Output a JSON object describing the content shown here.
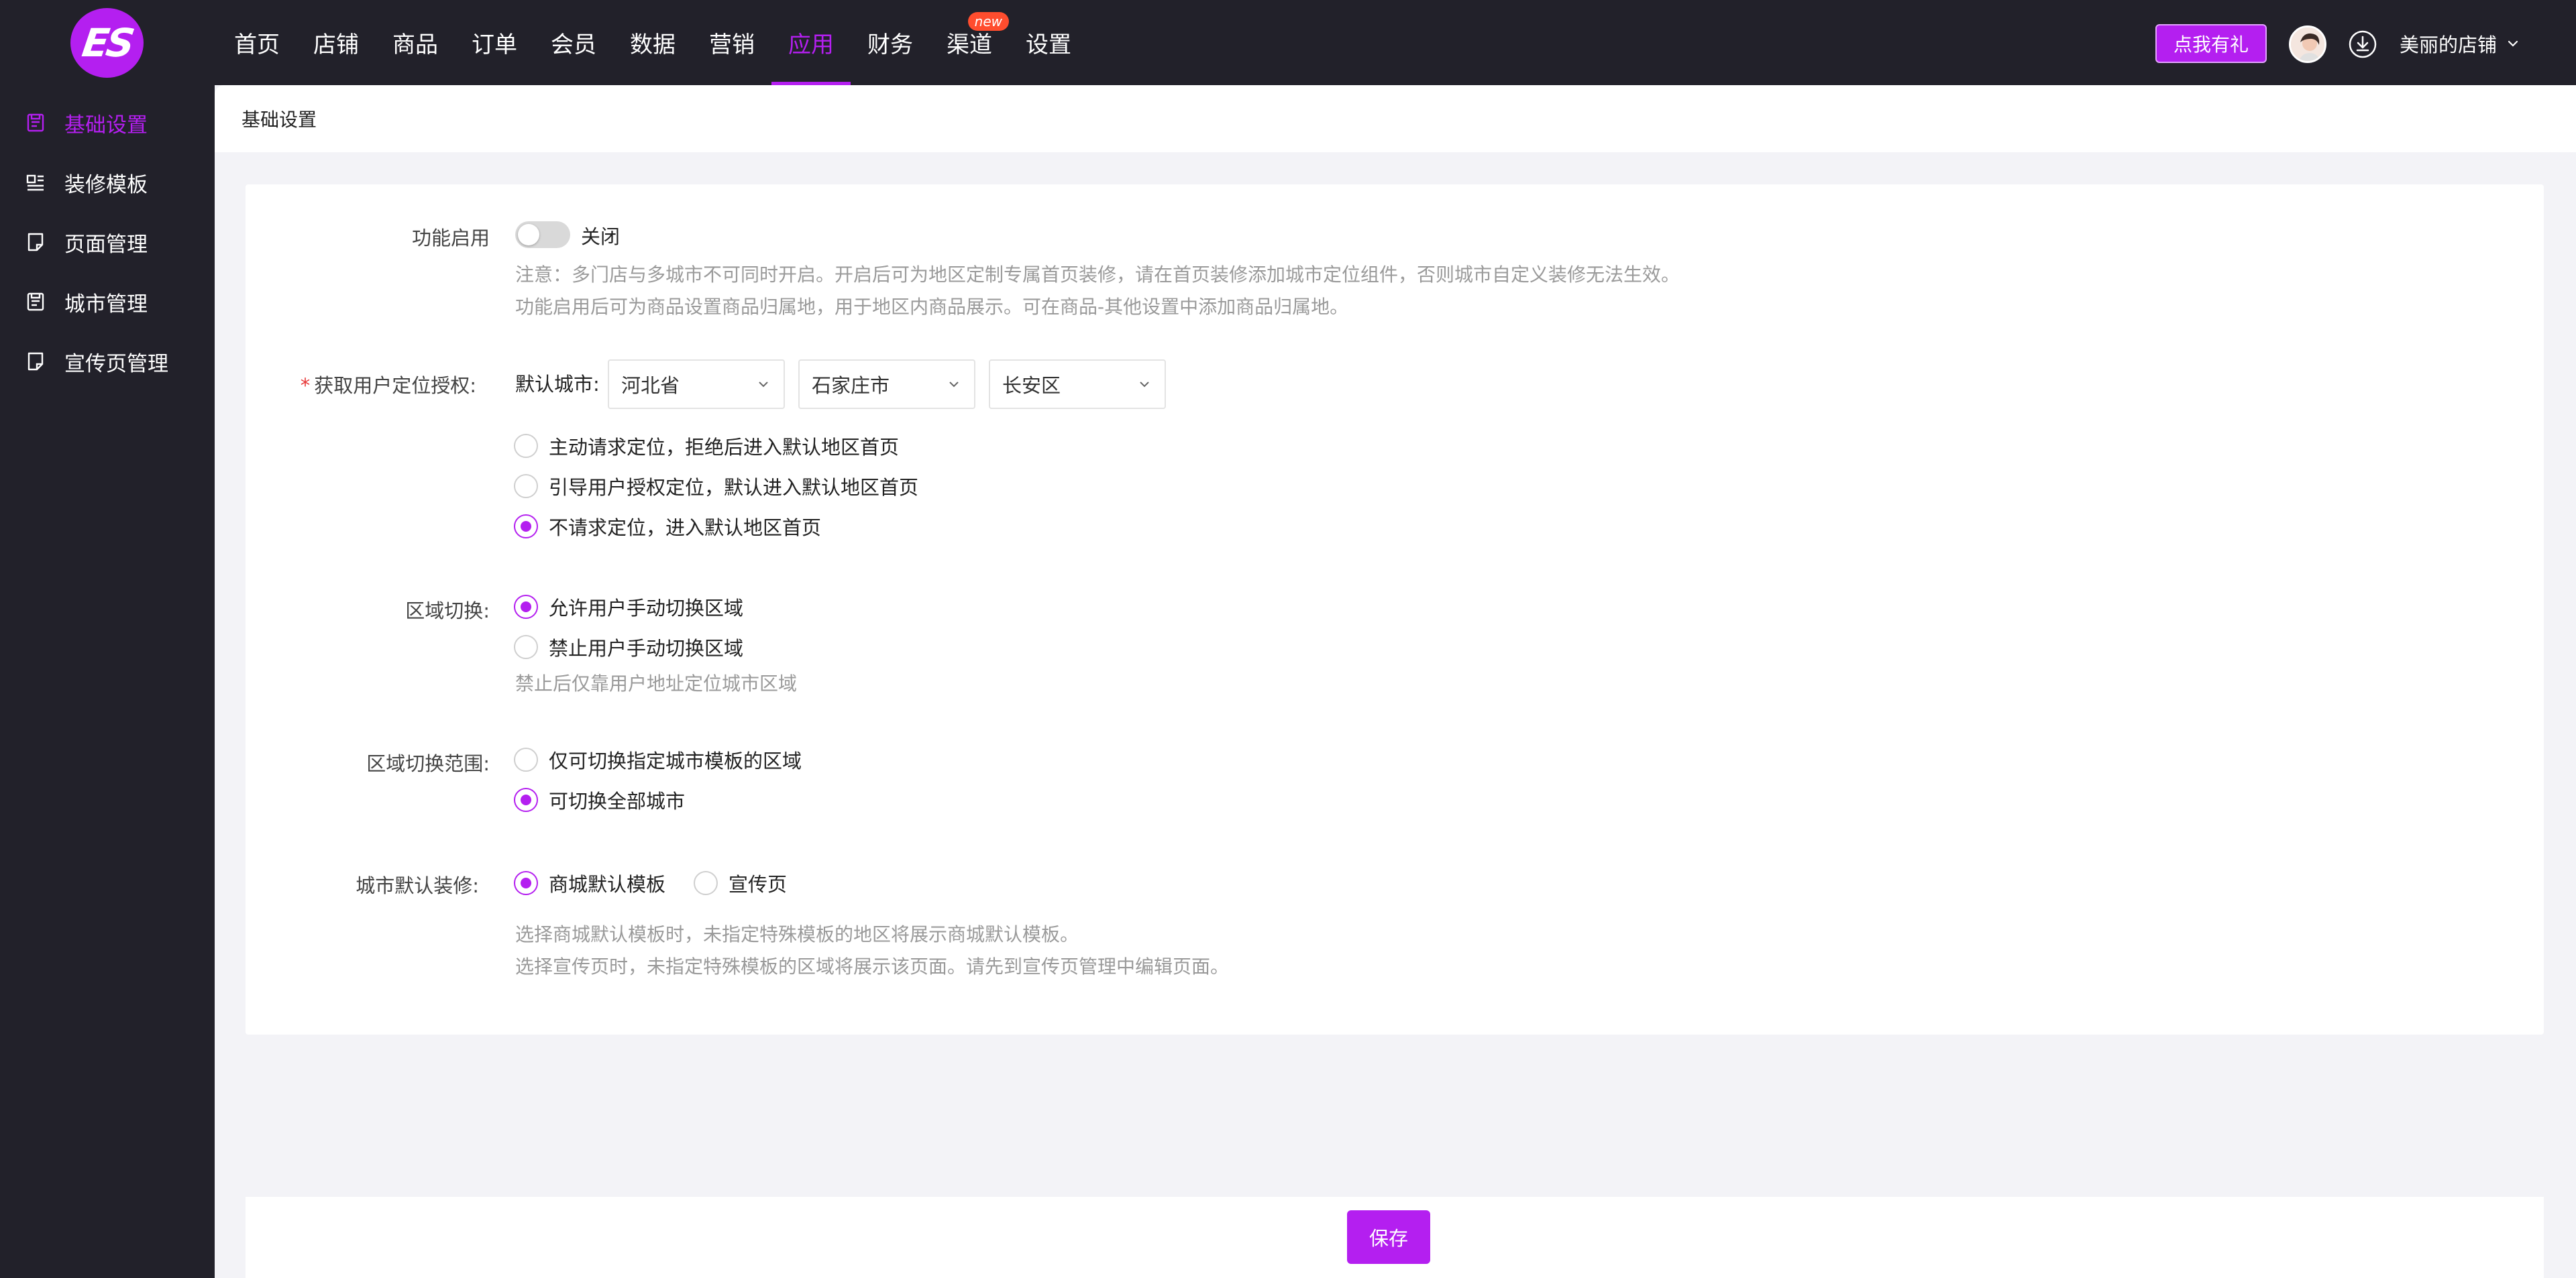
{
  "brand": {
    "logo_text": "ES",
    "accent": "#b41ff0"
  },
  "nav": [
    {
      "label": "首页"
    },
    {
      "label": "店铺"
    },
    {
      "label": "商品"
    },
    {
      "label": "订单"
    },
    {
      "label": "会员"
    },
    {
      "label": "数据"
    },
    {
      "label": "营销"
    },
    {
      "label": "应用",
      "active": true
    },
    {
      "label": "财务"
    },
    {
      "label": "渠道",
      "badge": "new"
    },
    {
      "label": "设置"
    }
  ],
  "header": {
    "gift_button": "点我有礼",
    "store_name": "美丽的店铺"
  },
  "sidebar": {
    "items": [
      {
        "label": "基础设置",
        "icon": "settings-doc-icon",
        "active": true
      },
      {
        "label": "装修模板",
        "icon": "template-icon"
      },
      {
        "label": "页面管理",
        "icon": "page-icon"
      },
      {
        "label": "城市管理",
        "icon": "city-icon"
      },
      {
        "label": "宣传页管理",
        "icon": "promo-page-icon"
      }
    ]
  },
  "tabbar": {
    "tab": "基础设置"
  },
  "form": {
    "feature": {
      "label": "功能启用",
      "toggle_text": "关闭",
      "hint1": "注意：多门店与多城市不可同时开启。开启后可为地区定制专属首页装修，请在首页装修添加城市定位组件，否则城市自定义装修无法生效。",
      "hint2": "功能启用后可为商品设置商品归属地，用于地区内商品展示。可在商品-其他设置中添加商品归属地。"
    },
    "location": {
      "required_mark": "*",
      "label": "获取用户定位授权:",
      "default_city_label": "默认城市:",
      "province": "河北省",
      "city": "石家庄市",
      "district": "长安区",
      "options": [
        "主动请求定位，拒绝后进入默认地区首页",
        "引导用户授权定位，默认进入默认地区首页",
        "不请求定位，进入默认地区首页"
      ],
      "selected": 2
    },
    "region_switch": {
      "label": "区域切换:",
      "options": [
        "允许用户手动切换区域",
        "禁止用户手动切换区域"
      ],
      "selected": 0,
      "hint": "禁止后仅靠用户地址定位城市区域"
    },
    "switch_scope": {
      "label": "区域切换范围:",
      "options": [
        "仅可切换指定城市模板的区域",
        "可切换全部城市"
      ],
      "selected": 1
    },
    "default_decoration": {
      "label": "城市默认装修:",
      "options": [
        "商城默认模板",
        "宣传页"
      ],
      "selected": 0,
      "hint1": "选择商城默认模板时，未指定特殊模板的地区将展示商城默认模板。",
      "hint2": "选择宣传页时，未指定特殊模板的区域将展示该页面。请先到宣传页管理中编辑页面。"
    }
  },
  "save_button": "保存"
}
